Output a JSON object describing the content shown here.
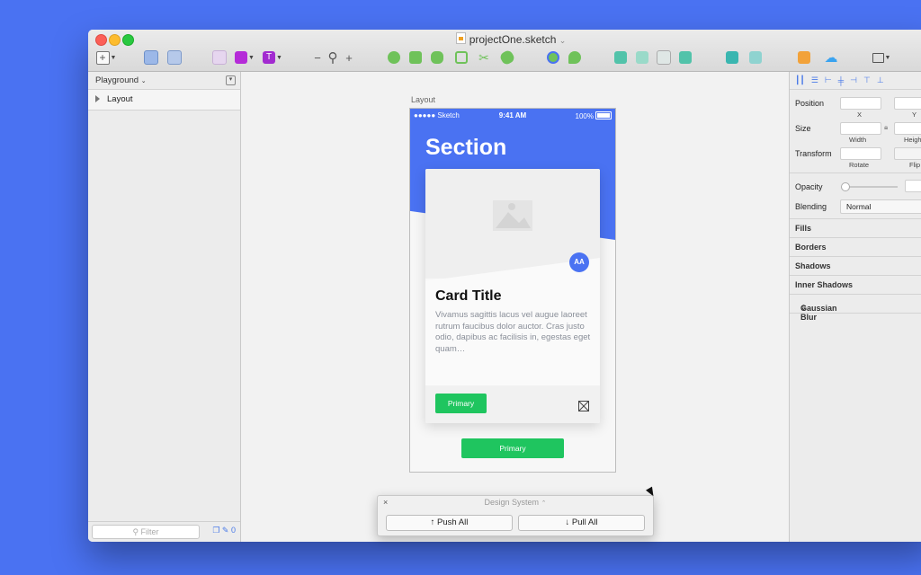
{
  "window": {
    "title": "projectOne.sketch",
    "title_caret": "⌄"
  },
  "toolbar": {
    "zoom_minus": "−",
    "zoom_plus": "+",
    "colors": {
      "insert_purple": "#b52bd8",
      "text_purple": "#a22bd0",
      "shape_green": "#6fc25a",
      "arrange_teal": "#52c3aa",
      "export_teal": "#3ab6b0",
      "sketch_orange": "#f2a23a",
      "cloud_blue": "#3aa3f0"
    }
  },
  "pages": {
    "current": "Playground",
    "layers": [
      {
        "label": "Layout"
      }
    ],
    "filter_placeholder": "Filter",
    "footer_count": "0"
  },
  "artboard": {
    "label": "Layout",
    "status": {
      "carrier": "●●●●● Sketch",
      "time": "9:41 AM",
      "battery": "100%"
    },
    "section_title": "Section",
    "card": {
      "avatar": "AA",
      "title": "Card Title",
      "text": "Vivamus sagittis lacus vel augue laoreet rutrum faucibus dolor auctor. Cras justo odio, dapibus ac facilisis in, egestas eget quam…",
      "primary": "Primary"
    },
    "primary_button": "Primary",
    "colors": {
      "brand_blue": "#4a72f2",
      "green": "#1fc55f"
    }
  },
  "inspector": {
    "position": "Position",
    "x": "X",
    "y": "Y",
    "size": "Size",
    "width": "Width",
    "height": "Heigh",
    "transform": "Transform",
    "rotate": "Rotate",
    "flip": "Flip",
    "opacity": "Opacity",
    "blending": "Blending",
    "blending_value": "Normal",
    "sections": [
      "Fills",
      "Borders",
      "Shadows",
      "Inner Shadows",
      "Gaussian Blur"
    ]
  },
  "design_system": {
    "title": "Design System",
    "close": "×",
    "push": "↑ Push All",
    "pull": "↓ Pull All"
  }
}
